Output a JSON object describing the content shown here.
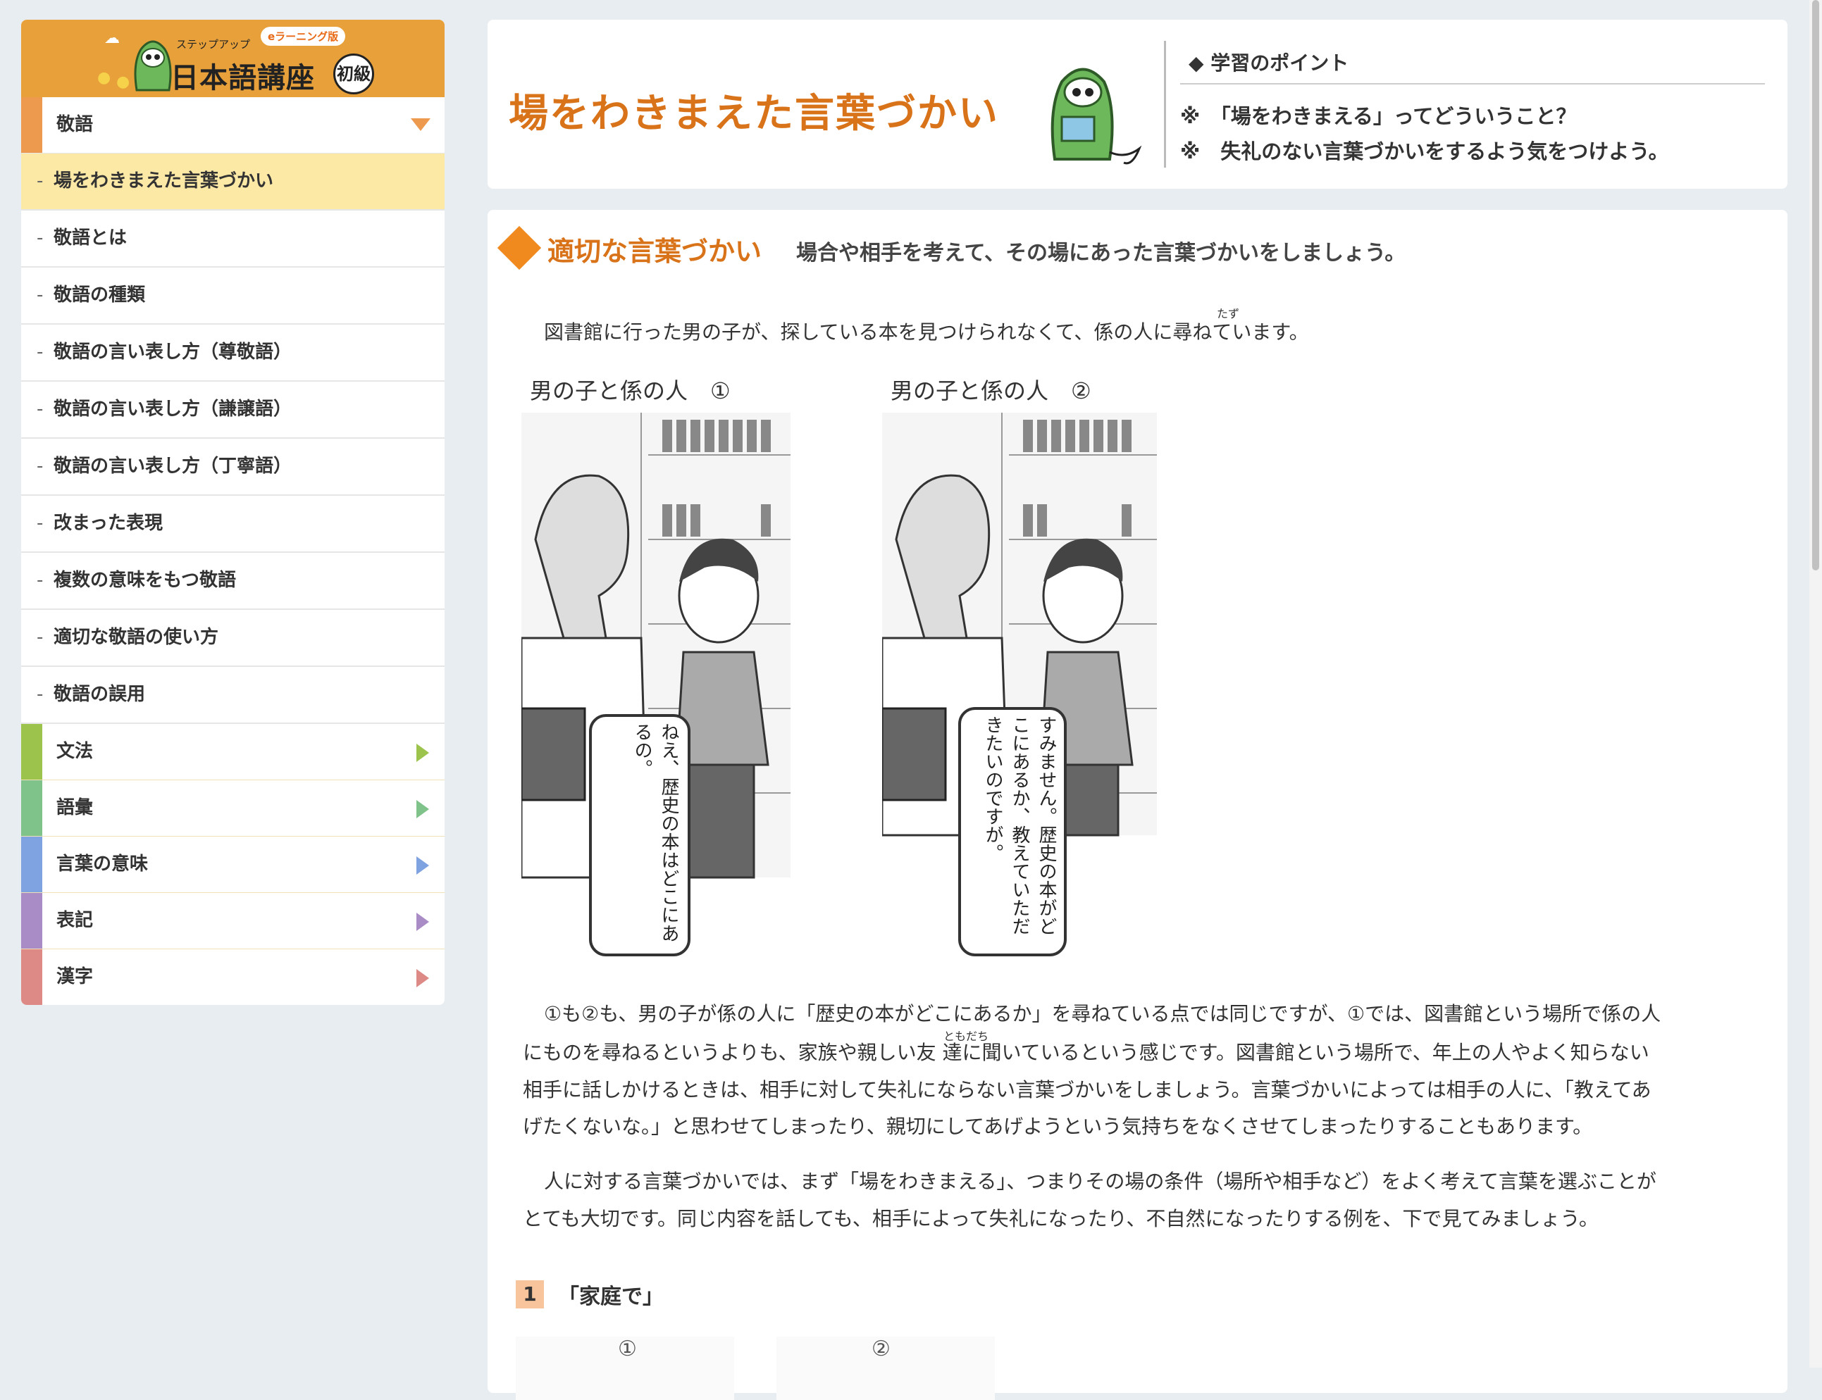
{
  "logo": {
    "step_label": "ステップアップ",
    "elearning_badge": "eラーニング版",
    "course_name": "日本語講座",
    "level": "初級"
  },
  "sidebar": {
    "categories": [
      {
        "label": "敬語",
        "color": "#ee9a4e",
        "expanded": true
      },
      {
        "label": "文法",
        "color": "#9cc34c"
      },
      {
        "label": "語彙",
        "color": "#7fc38a"
      },
      {
        "label": "言葉の意味",
        "color": "#7fa2e0"
      },
      {
        "label": "表記",
        "color": "#a98bc6"
      },
      {
        "label": "漢字",
        "color": "#dd8a86"
      }
    ],
    "subitems": [
      {
        "label": "場をわきまえた言葉づかい",
        "active": true
      },
      {
        "label": "敬語とは"
      },
      {
        "label": "敬語の種類"
      },
      {
        "label": "敬語の言い表し方（尊敬語）"
      },
      {
        "label": "敬語の言い表し方（謙譲語）"
      },
      {
        "label": "敬語の言い表し方（丁寧語）"
      },
      {
        "label": "改まった表現"
      },
      {
        "label": "複数の意味をもつ敬語"
      },
      {
        "label": "適切な敬語の使い方"
      },
      {
        "label": "敬語の誤用"
      }
    ],
    "dash": "-"
  },
  "header": {
    "title": "場をわきまえた言葉づかい",
    "points_heading": "◆ 学習のポイント",
    "points": [
      "※　「場をわきまえる」ってどういうこと？",
      "※　失礼のない言葉づかいをするよう気をつけよう。"
    ]
  },
  "content": {
    "section_title": "適切な言葉づかい",
    "section_subtitle": "場合や相手を考えて、その場にあった言葉づかいをしましょう。",
    "intro": "図書館に行った男の子が、探している本を見つけられなくて、係の人に尋ねています。",
    "intro_ruby": "たず",
    "illustrations": [
      {
        "caption": "男の子と係の人　①",
        "speech_lines": [
          "ねえ、歴史の本はどこにあ",
          "るの。"
        ]
      },
      {
        "caption": "男の子と係の人　②",
        "speech_lines": [
          "すみません。歴史の本がど",
          "こにあるか、教えていただ",
          "きたいのですが。"
        ]
      }
    ],
    "paragraph1_lines": [
      "①も②も、男の子が係の人に「歴史の本がどこにあるか」を尋ねている点では同じですが、①では、図書館という場所で係の人",
      "にものを尋ねるというよりも、家族や親しい友 達に聞いているという感じです。図書館という場所で、年上の人やよく知らない",
      "相手に話しかけるときは、相手に対して失礼にならない言葉づかいをしましょう。言葉づかいによっては相手の人に、「教えてあ",
      "げたくないな。」と思わせてしまったり、親切にしてあげようという気持ちをなくさせてしまったりすることもあります。"
    ],
    "paragraph1_ruby": "ともだち",
    "paragraph2_lines": [
      "人に対する言葉づかいでは、まず「場をわきまえる」、つまりその場の条件（場所や相手など）をよく考えて言葉を選ぶことが",
      "とても大切です。同じ内容を話しても、相手によって失礼になったり、不自然になったりする例を、下で見てみましょう。"
    ],
    "example_number": "1",
    "example_title": "「家庭で」",
    "example_markers": [
      "①",
      "②"
    ]
  }
}
